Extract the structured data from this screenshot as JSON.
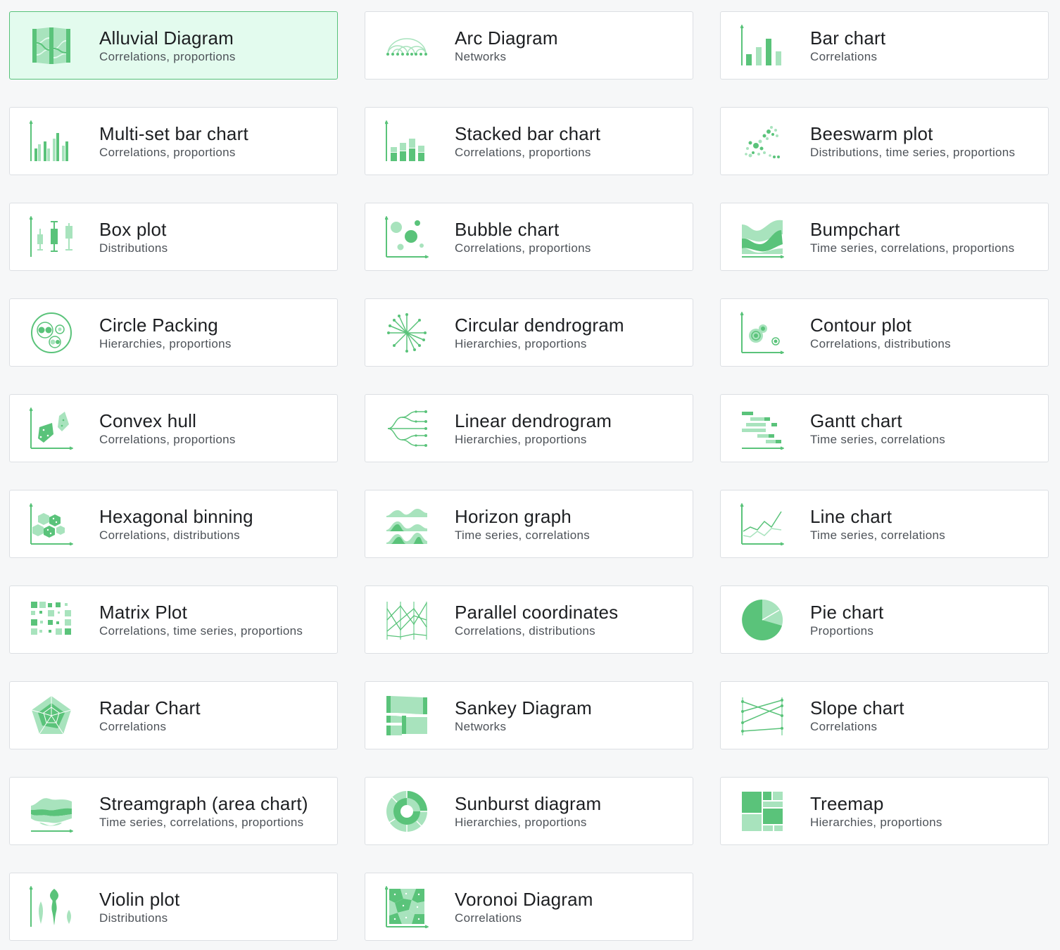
{
  "accent": "#5ac37a",
  "accent_light": "#a8e3bd",
  "selected_background": "#e3fbee",
  "selected_index": 0,
  "cards": [
    {
      "title": "Alluvial Diagram",
      "subtitle": "Correlations, proportions",
      "icon": "alluvial-icon"
    },
    {
      "title": "Arc Diagram",
      "subtitle": "Networks",
      "icon": "arc-diagram-icon"
    },
    {
      "title": "Bar chart",
      "subtitle": "Correlations",
      "icon": "bar-chart-icon"
    },
    {
      "title": "Multi-set bar chart",
      "subtitle": "Correlations, proportions",
      "icon": "multi-set-bar-chart-icon"
    },
    {
      "title": "Stacked bar chart",
      "subtitle": "Correlations, proportions",
      "icon": "stacked-bar-chart-icon"
    },
    {
      "title": "Beeswarm plot",
      "subtitle": "Distributions, time series, proportions",
      "icon": "beeswarm-plot-icon"
    },
    {
      "title": "Box plot",
      "subtitle": "Distributions",
      "icon": "box-plot-icon"
    },
    {
      "title": "Bubble chart",
      "subtitle": "Correlations, proportions",
      "icon": "bubble-chart-icon"
    },
    {
      "title": "Bumpchart",
      "subtitle": "Time series, correlations, proportions",
      "icon": "bumpchart-icon"
    },
    {
      "title": "Circle Packing",
      "subtitle": "Hierarchies, proportions",
      "icon": "circle-packing-icon"
    },
    {
      "title": "Circular dendrogram",
      "subtitle": "Hierarchies, proportions",
      "icon": "circular-dendrogram-icon"
    },
    {
      "title": "Contour plot",
      "subtitle": "Correlations, distributions",
      "icon": "contour-plot-icon"
    },
    {
      "title": "Convex hull",
      "subtitle": "Correlations, proportions",
      "icon": "convex-hull-icon"
    },
    {
      "title": "Linear dendrogram",
      "subtitle": "Hierarchies, proportions",
      "icon": "linear-dendrogram-icon"
    },
    {
      "title": "Gantt chart",
      "subtitle": "Time series, correlations",
      "icon": "gantt-chart-icon"
    },
    {
      "title": "Hexagonal binning",
      "subtitle": "Correlations, distributions",
      "icon": "hexagonal-binning-icon"
    },
    {
      "title": "Horizon graph",
      "subtitle": "Time series, correlations",
      "icon": "horizon-graph-icon"
    },
    {
      "title": "Line chart",
      "subtitle": "Time series, correlations",
      "icon": "line-chart-icon"
    },
    {
      "title": "Matrix Plot",
      "subtitle": "Correlations, time series, proportions",
      "icon": "matrix-plot-icon"
    },
    {
      "title": "Parallel coordinates",
      "subtitle": "Correlations, distributions",
      "icon": "parallel-coordinates-icon"
    },
    {
      "title": "Pie chart",
      "subtitle": "Proportions",
      "icon": "pie-chart-icon"
    },
    {
      "title": "Radar Chart",
      "subtitle": "Correlations",
      "icon": "radar-chart-icon"
    },
    {
      "title": "Sankey Diagram",
      "subtitle": "Networks",
      "icon": "sankey-diagram-icon"
    },
    {
      "title": "Slope chart",
      "subtitle": "Correlations",
      "icon": "slope-chart-icon"
    },
    {
      "title": "Streamgraph (area chart)",
      "subtitle": "Time series, correlations, proportions",
      "icon": "streamgraph-icon"
    },
    {
      "title": "Sunburst diagram",
      "subtitle": "Hierarchies, proportions",
      "icon": "sunburst-diagram-icon"
    },
    {
      "title": "Treemap",
      "subtitle": "Hierarchies, proportions",
      "icon": "treemap-icon"
    },
    {
      "title": "Violin plot",
      "subtitle": "Distributions",
      "icon": "violin-plot-icon"
    },
    {
      "title": "Voronoi Diagram",
      "subtitle": "Correlations",
      "icon": "voronoi-diagram-icon"
    }
  ]
}
